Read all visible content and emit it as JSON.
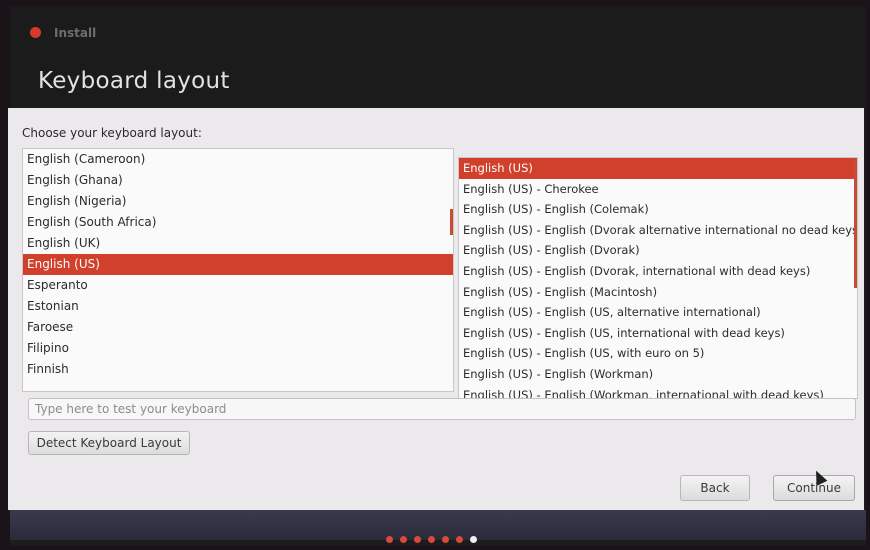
{
  "window": {
    "app_title": "Install",
    "page_title": "Keyboard layout"
  },
  "prompt": "Choose your keyboard layout:",
  "layouts": [
    "English (Cameroon)",
    "English (Ghana)",
    "English (Nigeria)",
    "English (South Africa)",
    "English (UK)",
    "English (US)",
    "Esperanto",
    "Estonian",
    "Faroese",
    "Filipino",
    "Finnish"
  ],
  "selected_layout": "English (US)",
  "variants": [
    "English (US)",
    "English (US) - Cherokee",
    "English (US) - English (Colemak)",
    "English (US) - English (Dvorak alternative international no dead keys)",
    "English (US) - English (Dvorak)",
    "English (US) - English (Dvorak, international with dead keys)",
    "English (US) - English (Macintosh)",
    "English (US) - English (US, alternative international)",
    "English (US) - English (US, international with dead keys)",
    "English (US) - English (US, with euro on 5)",
    "English (US) - English (Workman)",
    "English (US) - English (Workman, international with dead keys)"
  ],
  "selected_variant": "English (US)",
  "test_input": {
    "value": "",
    "placeholder": "Type here to test your keyboard"
  },
  "buttons": {
    "detect": "Detect Keyboard Layout",
    "back": "Back",
    "continue": "Continue"
  },
  "progress": {
    "total_steps": 7,
    "current_step": 7
  },
  "colors": {
    "accent": "#d0402b",
    "header_bg": "#1b1b1b"
  }
}
